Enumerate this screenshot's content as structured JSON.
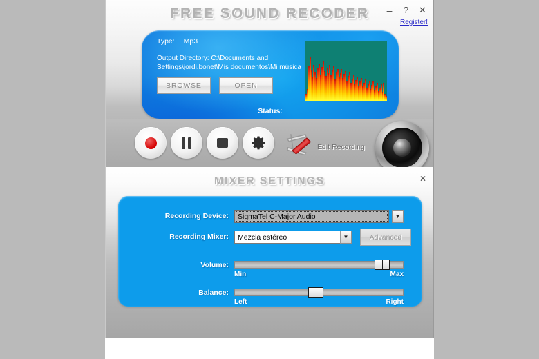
{
  "app": {
    "title": "FREE SOUND RECODER",
    "window_buttons": [
      {
        "name": "minimize",
        "glyph": "–"
      },
      {
        "name": "help",
        "glyph": "?"
      },
      {
        "name": "close",
        "glyph": "✕"
      }
    ],
    "register_link": "Register!"
  },
  "info": {
    "type_label": "Type:",
    "type_value": "Mp3",
    "directory_label": "Output Directory:",
    "directory_value": "C:\\Documents and Settings\\jordi.bonet\\Mis documentos\\Mi música",
    "browse_button": "BROWSE",
    "open_button": "OPEN",
    "status_label": "Status:",
    "visualizer": {
      "background_color": "#0e8073",
      "bar_gradient_low": "#ffff33",
      "bar_gradient_high": "#c01508",
      "levels": [
        12,
        20,
        58,
        74,
        52,
        40,
        61,
        48,
        38,
        56,
        62,
        44,
        57,
        66,
        50,
        42,
        55,
        47,
        60,
        43,
        52,
        58,
        36,
        49,
        54,
        41,
        47,
        53,
        38,
        45,
        50,
        34,
        42,
        48,
        30,
        37,
        44,
        28,
        35,
        40,
        26,
        33,
        38,
        24,
        30,
        36,
        22,
        28,
        34,
        20,
        27,
        32,
        18,
        24,
        30,
        16,
        22,
        28,
        15,
        30,
        12,
        8
      ]
    }
  },
  "transport": {
    "buttons": [
      {
        "name": "record-button",
        "icon": "record-icon"
      },
      {
        "name": "pause-button",
        "icon": "pause-icon"
      },
      {
        "name": "stop-button",
        "icon": "stop-icon"
      },
      {
        "name": "settings-button",
        "icon": "gear-icon"
      }
    ],
    "edit_recording_label": "Edit Recording"
  },
  "mixer": {
    "title": "MIXER SETTINGS",
    "close_glyph": "✕",
    "recording_device_label": "Recording Device:",
    "recording_device_value": "SigmaTel C-Major Audio",
    "recording_mixer_label": "Recording Mixer:",
    "recording_mixer_value": "Mezcla estéreo",
    "advanced_button": "Advanced",
    "volume_label": "Volume:",
    "volume_min_label": "Min",
    "volume_max_label": "Max",
    "volume_percent": 91,
    "balance_label": "Balance:",
    "balance_left_label": "Left",
    "balance_right_label": "Right",
    "balance_percent": 48,
    "arrow_glyph": "▼",
    "panel_color": "#0d9ceb"
  }
}
